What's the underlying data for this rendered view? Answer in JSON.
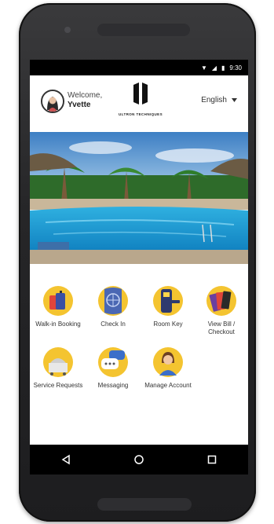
{
  "status": {
    "time": "9:30"
  },
  "header": {
    "welcome": "Welcome,",
    "user_name": "Yvette",
    "logo_text": "ULTRON TECHNIQUES",
    "language": "English"
  },
  "services": [
    {
      "label": "Walk-in Booking",
      "icon": "luggage-icon"
    },
    {
      "label": "Check In",
      "icon": "passport-icon"
    },
    {
      "label": "Room Key",
      "icon": "door-lock-icon"
    },
    {
      "label": "View Bill / Checkout",
      "icon": "credit-card-icon"
    },
    {
      "label": "Service Requests",
      "icon": "room-service-cart-icon"
    },
    {
      "label": "Messaging",
      "icon": "chat-bubbles-icon"
    },
    {
      "label": "Manage Account",
      "icon": "user-profile-icon"
    }
  ],
  "colors": {
    "accent": "#f4c430",
    "statusbar": "#000000"
  }
}
